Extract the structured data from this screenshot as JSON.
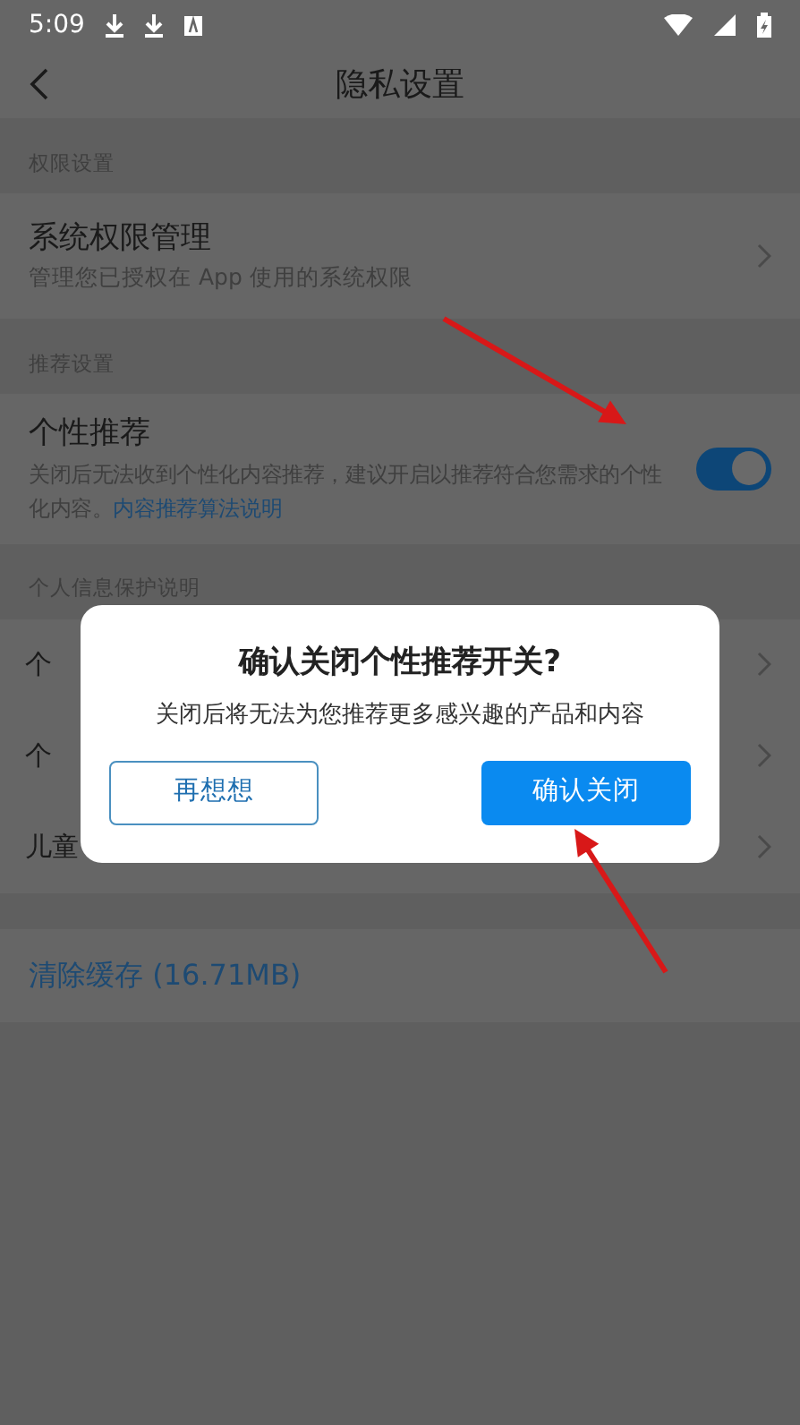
{
  "status_bar": {
    "time": "5:09"
  },
  "header": {
    "title": "隐私设置"
  },
  "sections": [
    {
      "label": "权限设置",
      "items": [
        {
          "kind": "nav",
          "title": "系统权限管理",
          "subtitle": "管理您已授权在 App 使用的系统权限"
        }
      ]
    },
    {
      "label": "推荐设置",
      "items": [
        {
          "kind": "toggle",
          "title": "个性推荐",
          "subtitle": "关闭后无法收到个性化内容推荐，建议开启以推荐符合您需求的个性化内容。",
          "link": "内容推荐算法说明",
          "on": true
        }
      ]
    },
    {
      "label": "个人信息保护说明",
      "items": [
        {
          "kind": "nav",
          "title": "个"
        },
        {
          "kind": "nav",
          "title": "个"
        },
        {
          "kind": "nav",
          "title": "儿童"
        }
      ]
    }
  ],
  "clear_cache": "清除缓存 (16.71MB)",
  "dialog": {
    "title": "确认关闭个性推荐开关?",
    "message": "关闭后将无法为您推荐更多感兴趣的产品和内容",
    "buttons": [
      {
        "label": "再想想",
        "kind": "secondary"
      },
      {
        "label": "确认关闭",
        "kind": "primary"
      }
    ]
  }
}
